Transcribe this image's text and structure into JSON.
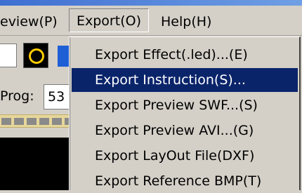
{
  "menubar": {
    "items": [
      {
        "label": "eview(P)"
      },
      {
        "label": "Export(O)"
      },
      {
        "label": "Help(H)"
      }
    ]
  },
  "left_panel": {
    "prog_label": "Prog:",
    "prog_value": "53"
  },
  "export_menu": {
    "items": [
      {
        "label": "Export Effect(.led)...(E)"
      },
      {
        "label": "Export Instruction(S)..."
      },
      {
        "label": "Export Preview SWF...(S)"
      },
      {
        "label": "Export Preview AVI...(G)"
      },
      {
        "label": "Export LayOut File(DXF)"
      },
      {
        "label": "Export Reference BMP(T)"
      }
    ],
    "selected_index": 1
  },
  "colors": {
    "menu_background": "#d4d0c8",
    "selection_background": "#0a246a",
    "selection_text": "#ffffff"
  }
}
